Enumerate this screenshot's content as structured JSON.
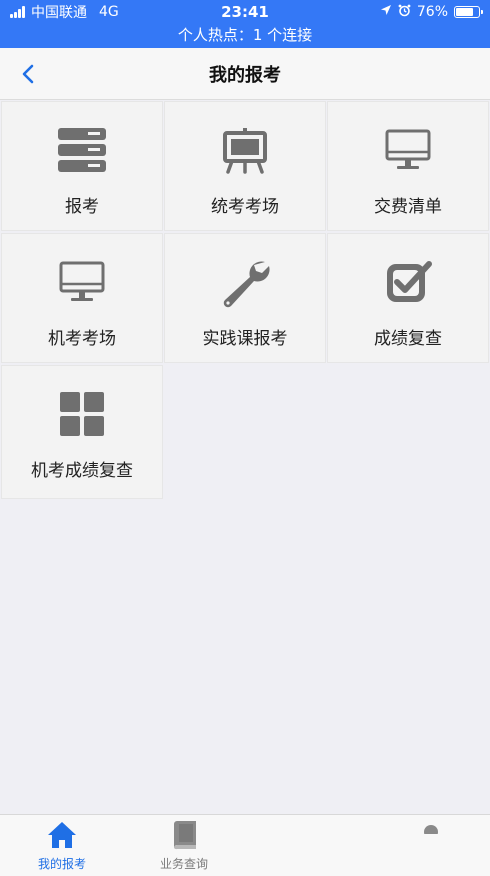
{
  "status_bar": {
    "carrier": "中国联通",
    "network": "4G",
    "time": "23:41",
    "battery": "76%",
    "battery_level": 0.76,
    "hotspot": "个人热点：1 个连接"
  },
  "nav": {
    "title": "我的报考",
    "back_icon": "chevron-left-icon"
  },
  "menu": {
    "items": [
      {
        "label": "报考",
        "icon": "server-icon"
      },
      {
        "label": "统考考场",
        "icon": "easel-icon"
      },
      {
        "label": "交费清单",
        "icon": "monitor-icon"
      },
      {
        "label": "机考考场",
        "icon": "monitor-icon"
      },
      {
        "label": "实践课报考",
        "icon": "wrench-icon"
      },
      {
        "label": "成绩复查",
        "icon": "check-square-icon"
      },
      {
        "label": "机考成绩复查",
        "icon": "grid-icon"
      }
    ]
  },
  "tabbar": {
    "tabs": [
      {
        "label": "我的报考",
        "icon": "home-icon",
        "active": true
      },
      {
        "label": "业务查询",
        "icon": "book-icon",
        "active": false
      }
    ]
  },
  "colors": {
    "primary": "#1f6fe5",
    "status_bg": "#3478f6",
    "icon_gray": "#6f6f6f"
  }
}
